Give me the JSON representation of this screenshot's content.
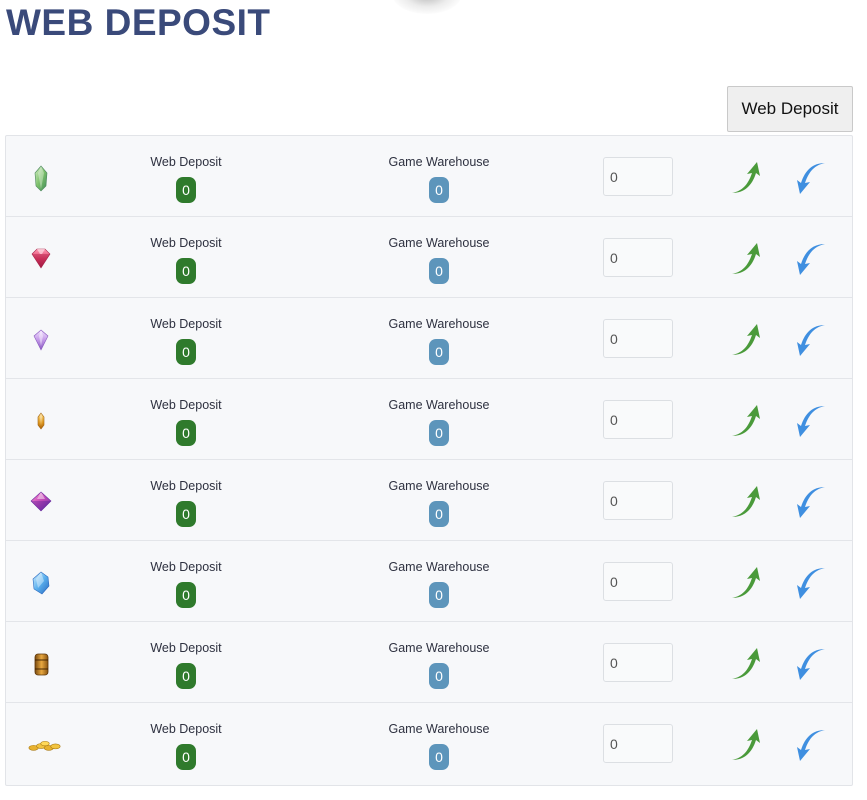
{
  "page": {
    "title": "WEB DEPOSIT",
    "top_button_label": "Web Deposit"
  },
  "colors": {
    "title": "#3a4a7a",
    "web_badge": "#2f7a2c",
    "warehouse_badge": "#5d95bb",
    "deposit_arrow": "#4a9a3a",
    "withdraw_arrow": "#3f8fe0"
  },
  "rows": [
    {
      "icon": "green-crystal-icon",
      "web_label": "Web Deposit",
      "web_value": "0",
      "warehouse_label": "Game Warehouse",
      "warehouse_value": "0",
      "input_value": "0"
    },
    {
      "icon": "red-gem-icon",
      "web_label": "Web Deposit",
      "web_value": "0",
      "warehouse_label": "Game Warehouse",
      "warehouse_value": "0",
      "input_value": "0"
    },
    {
      "icon": "purple-gem-icon",
      "web_label": "Web Deposit",
      "web_value": "0",
      "warehouse_label": "Game Warehouse",
      "warehouse_value": "0",
      "input_value": "0"
    },
    {
      "icon": "amber-crystal-icon",
      "web_label": "Web Deposit",
      "web_value": "0",
      "warehouse_label": "Game Warehouse",
      "warehouse_value": "0",
      "input_value": "0"
    },
    {
      "icon": "pink-diamond-icon",
      "web_label": "Web Deposit",
      "web_value": "0",
      "warehouse_label": "Game Warehouse",
      "warehouse_value": "0",
      "input_value": "0"
    },
    {
      "icon": "blue-crystal-icon",
      "web_label": "Web Deposit",
      "web_value": "0",
      "warehouse_label": "Game Warehouse",
      "warehouse_value": "0",
      "input_value": "0"
    },
    {
      "icon": "gold-stone-icon",
      "web_label": "Web Deposit",
      "web_value": "0",
      "warehouse_label": "Game Warehouse",
      "warehouse_value": "0",
      "input_value": "0"
    },
    {
      "icon": "gold-coins-icon",
      "web_label": "Web Deposit",
      "web_value": "0",
      "warehouse_label": "Game Warehouse",
      "warehouse_value": "0",
      "input_value": "0"
    }
  ],
  "actions": {
    "deposit_icon": "deposit-arrow-up-icon",
    "withdraw_icon": "withdraw-arrow-down-icon"
  }
}
